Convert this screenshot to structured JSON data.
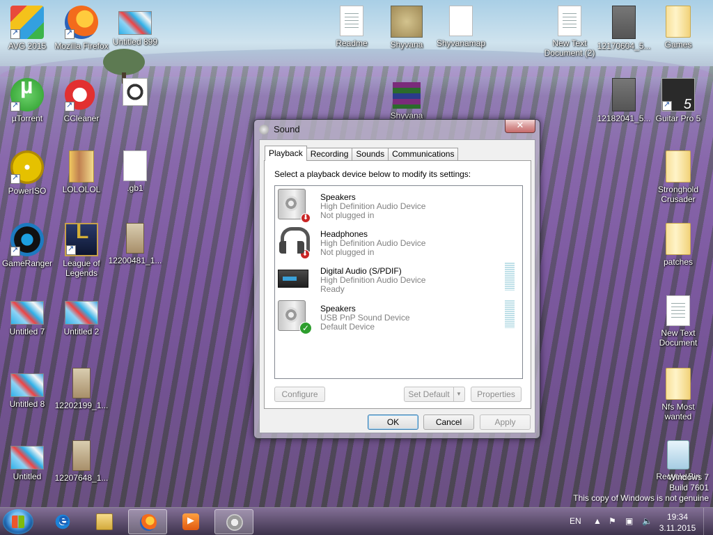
{
  "desktop": {
    "icons": [
      {
        "label": "AVG 2015",
        "shortcut": true,
        "icon": "avg-icon"
      },
      {
        "label": "Mozilla Firefox",
        "shortcut": true,
        "icon": "firefox-icon"
      },
      {
        "label": "Untitled 899",
        "shortcut": false,
        "icon": "image-icon"
      },
      {
        "label": "Readme",
        "shortcut": false,
        "icon": "text-document-icon"
      },
      {
        "label": "Shyvana",
        "shortcut": false,
        "icon": "map-image-icon"
      },
      {
        "label": "Shyvanamap",
        "shortcut": false,
        "icon": "blank-file-icon"
      },
      {
        "label": "New Text Document (2)",
        "shortcut": false,
        "icon": "text-document-icon"
      },
      {
        "label": "12170604_5...",
        "shortcut": false,
        "icon": "photo-icon"
      },
      {
        "label": "Games",
        "shortcut": false,
        "icon": "folder-icon"
      },
      {
        "label": "µTorrent",
        "shortcut": true,
        "icon": "utorrent-icon"
      },
      {
        "label": "CCleaner",
        "shortcut": true,
        "icon": "ccleaner-icon"
      },
      {
        "label": "",
        "shortcut": false,
        "icon": "gear-file-icon"
      },
      {
        "label": "Shyvana",
        "shortcut": false,
        "icon": "winrar-archive-icon"
      },
      {
        "label": "12182041_5...",
        "shortcut": false,
        "icon": "photo-icon"
      },
      {
        "label": "Guitar Pro 5",
        "shortcut": true,
        "icon": "guitar-pro-icon"
      },
      {
        "label": "PowerISO",
        "shortcut": true,
        "icon": "poweriso-icon"
      },
      {
        "label": "LOLOLOL",
        "shortcut": false,
        "icon": "folder-image-icon"
      },
      {
        "label": ".gb1",
        "shortcut": false,
        "icon": "blank-file-icon"
      },
      {
        "label": "Stronghold Crusader",
        "shortcut": false,
        "icon": "folder-icon"
      },
      {
        "label": "GameRanger",
        "shortcut": true,
        "icon": "gameranger-icon"
      },
      {
        "label": "League of Legends",
        "shortcut": true,
        "icon": "league-of-legends-icon"
      },
      {
        "label": "12200481_1...",
        "shortcut": false,
        "icon": "photo-icon"
      },
      {
        "label": "patches",
        "shortcut": false,
        "icon": "folder-icon"
      },
      {
        "label": "Untitled 7",
        "shortcut": false,
        "icon": "image-icon"
      },
      {
        "label": "Untitled 2",
        "shortcut": false,
        "icon": "image-icon"
      },
      {
        "label": "New Text Document",
        "shortcut": false,
        "icon": "text-document-icon"
      },
      {
        "label": "Untitled 8",
        "shortcut": false,
        "icon": "image-icon"
      },
      {
        "label": "12202199_1...",
        "shortcut": false,
        "icon": "photo-icon"
      },
      {
        "label": "Nfs Most wanted",
        "shortcut": false,
        "icon": "folder-icon"
      },
      {
        "label": "Untitled",
        "shortcut": false,
        "icon": "image-icon"
      },
      {
        "label": "12207648_1...",
        "shortcut": false,
        "icon": "photo-icon"
      },
      {
        "label": "Recycle Bin",
        "shortcut": false,
        "icon": "recycle-bin-icon"
      }
    ],
    "watermark": {
      "line1": "Windows 7",
      "line2": "Build 7601",
      "line3": "This copy of Windows is not genuine"
    }
  },
  "dialog": {
    "title": "Sound",
    "close_label": "✕",
    "tabs": [
      {
        "label": "Playback",
        "active": true
      },
      {
        "label": "Recording",
        "active": false
      },
      {
        "label": "Sounds",
        "active": false
      },
      {
        "label": "Communications",
        "active": false
      }
    ],
    "instruction": "Select a playback device below to modify its settings:",
    "devices": [
      {
        "name": "Speakers",
        "driver": "High Definition Audio Device",
        "status": "Not plugged in",
        "icon": "speaker-icon",
        "badge": "unplugged"
      },
      {
        "name": "Headphones",
        "driver": "High Definition Audio Device",
        "status": "Not plugged in",
        "icon": "headphones-icon",
        "badge": "unplugged"
      },
      {
        "name": "Digital Audio (S/PDIF)",
        "driver": "High Definition Audio Device",
        "status": "Ready",
        "icon": "digital-audio-icon",
        "badge": "none"
      },
      {
        "name": "Speakers",
        "driver": "USB PnP Sound Device",
        "status": "Default Device",
        "icon": "speaker-icon",
        "badge": "default"
      }
    ],
    "buttons": {
      "configure": "Configure",
      "set_default": "Set Default",
      "properties": "Properties",
      "ok": "OK",
      "cancel": "Cancel",
      "apply": "Apply"
    }
  },
  "taskbar": {
    "items": [
      {
        "name": "internet-explorer",
        "active": false
      },
      {
        "name": "windows-explorer",
        "active": false
      },
      {
        "name": "firefox",
        "active": true
      },
      {
        "name": "windows-media-player",
        "active": false
      },
      {
        "name": "sound",
        "active": true
      }
    ],
    "tray": {
      "language": "EN",
      "time": "19:34",
      "date": "3.11.2015"
    }
  }
}
